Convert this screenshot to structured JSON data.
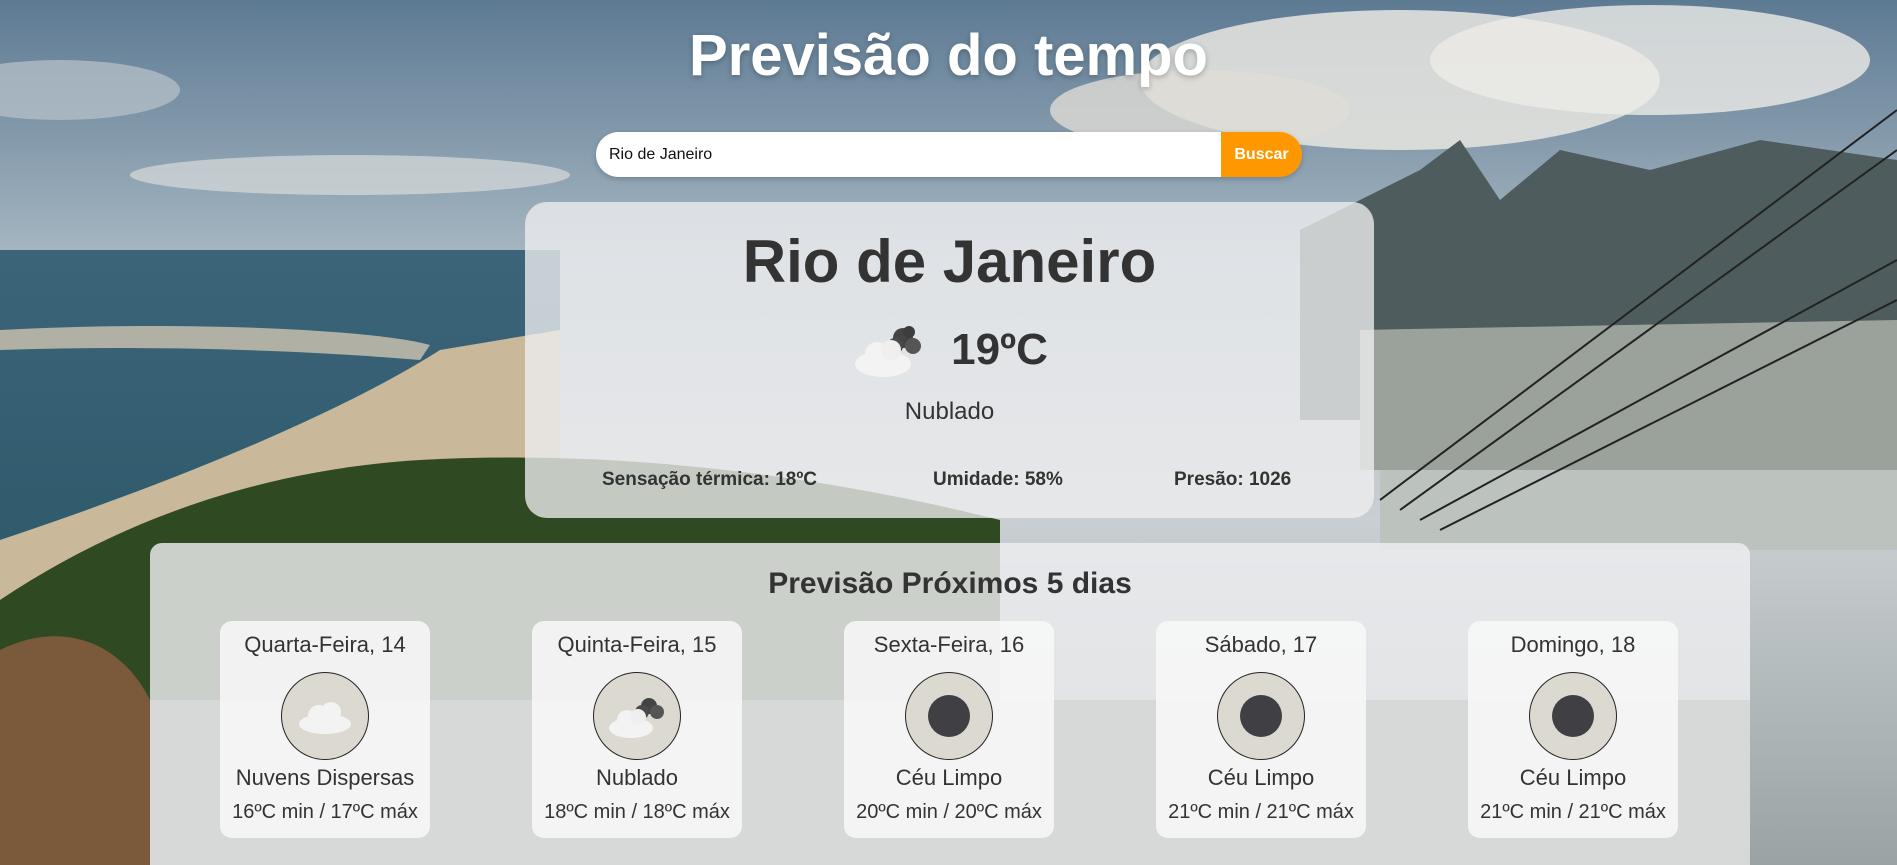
{
  "app": {
    "title": "Previsão do tempo"
  },
  "search": {
    "value": "Rio de Janeiro",
    "button_label": "Buscar"
  },
  "current": {
    "city": "Rio de Janeiro",
    "temp": "19ºC",
    "description": "Nublado",
    "icon": "broken-clouds-icon",
    "feels_like": "Sensação térmica: 18ºC",
    "humidity": "Umidade: 58%",
    "pressure": "Presão: 1026"
  },
  "forecast": {
    "title": "Previsão Próximos 5 dias",
    "days": [
      {
        "title": "Quarta-Feira, 14",
        "description": "Nuvens Dispersas",
        "range": "16ºC min / 17ºC máx",
        "icon": "scattered-clouds-icon"
      },
      {
        "title": "Quinta-Feira, 15",
        "description": "Nublado",
        "range": "18ºC min / 18ºC máx",
        "icon": "broken-clouds-icon"
      },
      {
        "title": "Sexta-Feira, 16",
        "description": "Céu Limpo",
        "range": "20ºC min / 20ºC máx",
        "icon": "clear-sky-icon"
      },
      {
        "title": "Sábado, 17",
        "description": "Céu Limpo",
        "range": "21ºC min / 21ºC máx",
        "icon": "clear-sky-icon"
      },
      {
        "title": "Domingo, 18",
        "description": "Céu Limpo",
        "range": "21ºC min / 21ºC máx",
        "icon": "clear-sky-icon"
      }
    ]
  },
  "colors": {
    "accent": "#ff9800",
    "text": "#333333"
  }
}
